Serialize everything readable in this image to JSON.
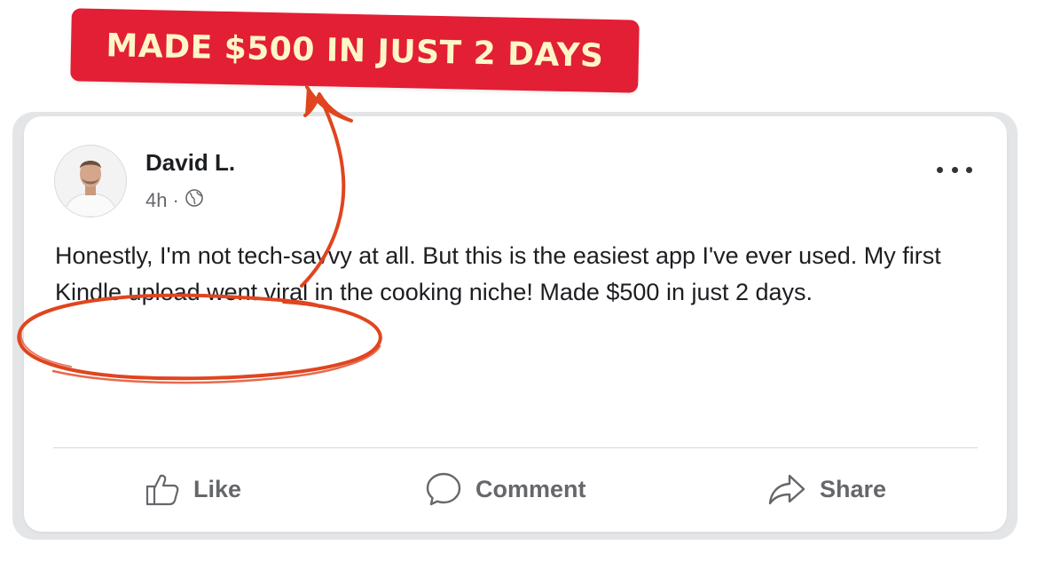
{
  "banner": {
    "text": "MADE $500 IN JUST 2 DAYS",
    "background": "#e21f35",
    "text_color": "#fff6c8"
  },
  "post": {
    "author": "David L.",
    "time": "4h",
    "separator": "·",
    "privacy_icon": "globe-icon",
    "more_icon": "ellipsis-icon",
    "body": "Honestly, I'm not tech-savvy at all. But this is the easiest app I've ever used. My first Kindle upload went viral in the cooking niche! Made $500 in just 2 days."
  },
  "actions": {
    "like": {
      "label": "Like",
      "icon": "thumbs-up-icon"
    },
    "comment": {
      "label": "Comment",
      "icon": "comment-bubble-icon"
    },
    "share": {
      "label": "Share",
      "icon": "share-arrow-icon"
    }
  },
  "annotations": {
    "color": "#e0451f",
    "circle": "hand-drawn-ellipse",
    "arrow": "curved-arrow-pointing-up"
  }
}
